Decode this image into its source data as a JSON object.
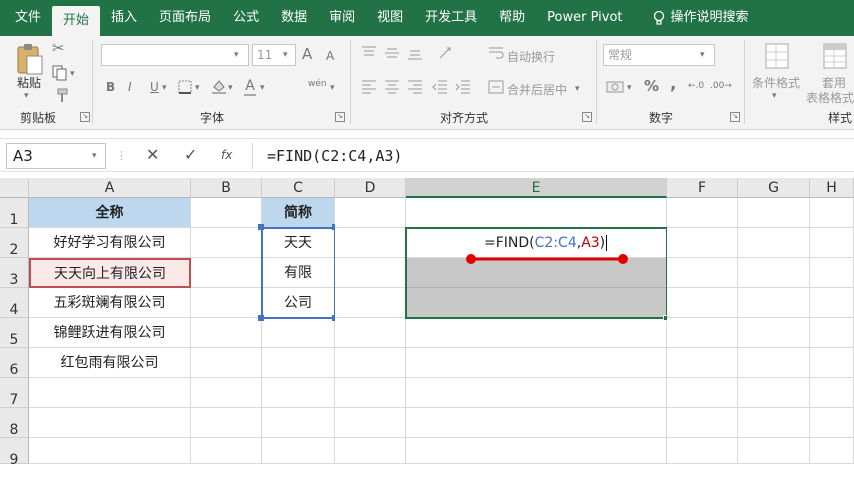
{
  "ribbon_tabs": [
    "文件",
    "开始",
    "插入",
    "页面布局",
    "公式",
    "数据",
    "审阅",
    "视图",
    "开发工具",
    "帮助",
    "Power Pivot"
  ],
  "active_tab": "开始",
  "search_label": "操作说明搜索",
  "clipboard": {
    "paste": "粘贴",
    "group": "剪贴板"
  },
  "font": {
    "size": "11",
    "group": "字体",
    "bold": "B",
    "italic": "I",
    "underline": "U",
    "grow": "A",
    "shrink": "A",
    "wen": "wén"
  },
  "alignment": {
    "wrap": "自动换行",
    "merge": "合并后居中",
    "group": "对齐方式"
  },
  "number": {
    "format": "常规",
    "percent": "%",
    "comma": ",",
    "group": "数字"
  },
  "styles": {
    "cond": "条件格式",
    "table1": "套用",
    "table2": "表格格式",
    "group": "样式"
  },
  "formula_bar": {
    "name_box": "A3",
    "fx": "fx",
    "formula": "=FIND(C2:C4,A3)"
  },
  "columns": [
    "A",
    "B",
    "C",
    "D",
    "E",
    "F",
    "G",
    "H"
  ],
  "rows": [
    "1",
    "2",
    "3",
    "4",
    "5",
    "6",
    "7",
    "8",
    "9"
  ],
  "cells": {
    "a1": "全称",
    "a2": "好好学习有限公司",
    "a3": "天天向上有限公司",
    "a4": "五彩斑斓有限公司",
    "a5": "锦鲤跃进有限公司",
    "a6": "红包雨有限公司",
    "c1": "简称",
    "c2": "天天",
    "c3": "有限",
    "c4": "公司"
  },
  "edit_formula": {
    "prefix": "=FIND(",
    "ref1": "C2:C4",
    "comma": ",",
    "ref2": "A3",
    "suffix": ")"
  },
  "colors": {
    "excel_green": "#217346",
    "header_blue": "#bdd7ee",
    "ref1_color": "#4472c4",
    "ref2_color": "#c00000",
    "annotation_red": "#e00000"
  }
}
